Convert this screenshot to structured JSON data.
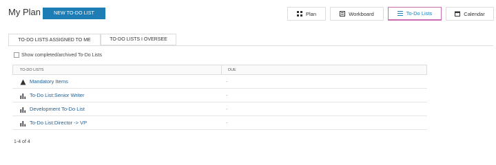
{
  "header": {
    "title": "My Plan",
    "new_button": "NEW TO-DO LIST"
  },
  "nav": {
    "plan": "Plan",
    "workboard": "Workboard",
    "todo_lists": "To-Do Lists",
    "calendar": "Calendar"
  },
  "tabs": {
    "assigned": "TO-DO LISTS ASSIGNED TO ME",
    "oversee": "TO-DO LISTS I OVERSEE"
  },
  "filter": {
    "show_completed": "Show completed/archived To-Do Lists"
  },
  "table": {
    "col_lists": "TO-DO LISTS",
    "col_due": "DUE",
    "rows": [
      {
        "icon": "warning-icon",
        "name": "Mandatory Items",
        "due": "-"
      },
      {
        "icon": "bar-chart-icon",
        "name": "To-Do List:Senior Writer",
        "due": "-"
      },
      {
        "icon": "bar-chart-icon",
        "name": "Development To-Do List",
        "due": "-"
      },
      {
        "icon": "bar-chart-icon",
        "name": "To-Do List:Director -> VP",
        "due": "-"
      }
    ]
  },
  "pagination": "1-4 of 4",
  "colors": {
    "accent": "#1f7db5",
    "active_border": "#c76db0",
    "link": "#1f5f96"
  }
}
